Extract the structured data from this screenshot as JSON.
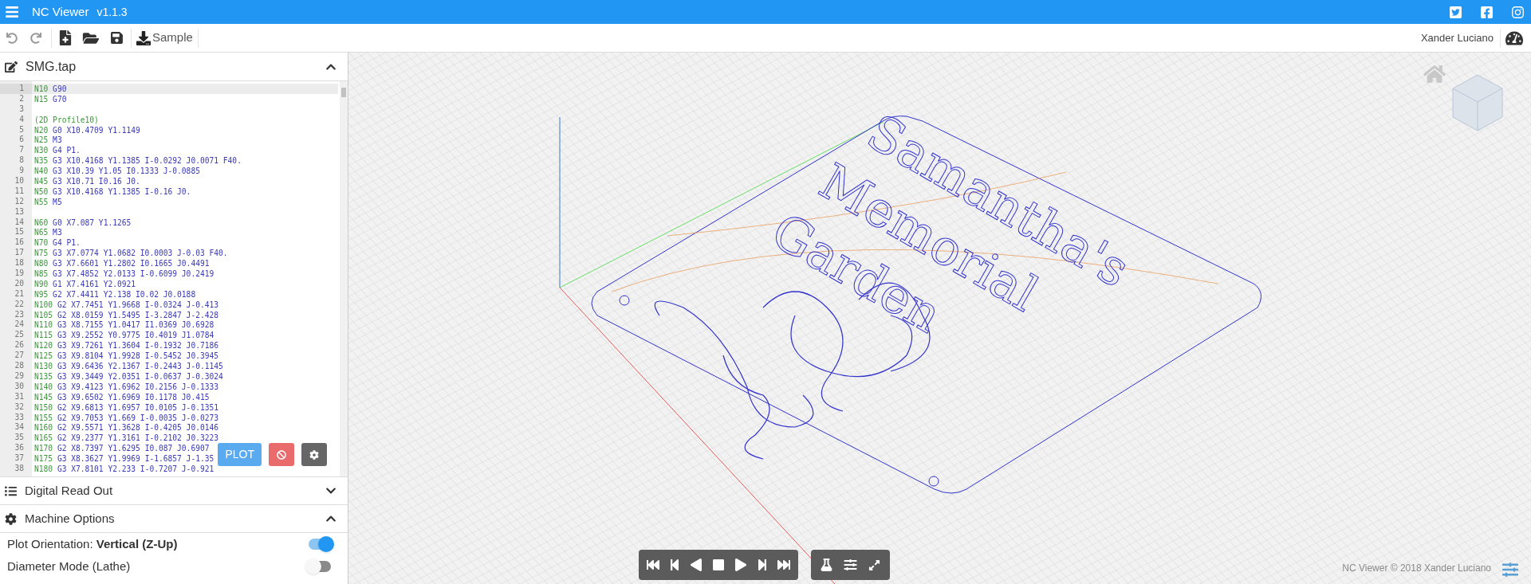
{
  "app_bar": {
    "title": "NC Viewer",
    "version": "v1.1.3"
  },
  "toolbar": {
    "sample_label": "Sample",
    "user": "Xander Luciano"
  },
  "editor": {
    "file_name": "SMG.tap",
    "expanded": true,
    "lines": [
      {
        "number": "1",
        "kind": "block",
        "text": "N10 G90",
        "selected": true
      },
      {
        "number": "2",
        "kind": "block",
        "text": "N15 G70",
        "selected": false
      },
      {
        "number": "3",
        "kind": "blank",
        "selected": false
      },
      {
        "number": "4",
        "kind": "comment",
        "text": "(2D Profile10)",
        "selected": false
      },
      {
        "number": "5",
        "kind": "block",
        "text": "N20 G0 X10.4709 Y1.1149",
        "selected": false
      },
      {
        "number": "6",
        "kind": "block",
        "text": "N25 M3",
        "selected": false
      },
      {
        "number": "7",
        "kind": "block",
        "text": "N30 G4 P1.",
        "selected": false
      },
      {
        "number": "8",
        "kind": "block",
        "text": "N35 G3 X10.4168 Y1.1385 I-0.0292 J0.0071 F40.",
        "selected": false
      },
      {
        "number": "9",
        "kind": "block",
        "text": "N40 G3 X10.39 Y1.05 I0.1333 J-0.0885",
        "selected": false
      },
      {
        "number": "10",
        "kind": "block",
        "text": "N45 G3 X10.71 I0.16 J0.",
        "selected": false
      },
      {
        "number": "11",
        "kind": "block",
        "text": "N50 G3 X10.4168 Y1.1385 I-0.16 J0.",
        "selected": false
      },
      {
        "number": "12",
        "kind": "block",
        "text": "N55 M5",
        "selected": false
      },
      {
        "number": "13",
        "kind": "blank",
        "selected": false
      },
      {
        "number": "14",
        "kind": "block",
        "text": "N60 G0 X7.087 Y1.1265",
        "selected": false
      },
      {
        "number": "15",
        "kind": "block",
        "text": "N65 M3",
        "selected": false
      },
      {
        "number": "16",
        "kind": "block",
        "text": "N70 G4 P1.",
        "selected": false
      },
      {
        "number": "17",
        "kind": "block",
        "text": "N75 G3 X7.0774 Y1.0682 I0.0003 J-0.03 F40.",
        "selected": false
      },
      {
        "number": "18",
        "kind": "block",
        "text": "N80 G3 X7.6601 Y1.2802 I0.1665 J0.4491",
        "selected": false
      },
      {
        "number": "19",
        "kind": "block",
        "text": "N85 G3 X7.4852 Y2.0133 I-0.6099 J0.2419",
        "selected": false
      },
      {
        "number": "20",
        "kind": "block",
        "text": "N90 G1 X7.4161 Y2.0921",
        "selected": false
      },
      {
        "number": "21",
        "kind": "block",
        "text": "N95 G2 X7.4411 Y2.138 I0.02 J0.0188",
        "selected": false
      },
      {
        "number": "22",
        "kind": "block",
        "text": "N100 G2 X7.7451 Y1.9668 I-0.0324 J-0.413",
        "selected": false
      },
      {
        "number": "23",
        "kind": "block",
        "text": "N105 G2 X8.0159 Y1.5495 I-3.2847 J-2.428",
        "selected": false
      },
      {
        "number": "24",
        "kind": "block",
        "text": "N110 G3 X8.7155 Y1.0417 I1.0369 J0.6928",
        "selected": false
      },
      {
        "number": "25",
        "kind": "block",
        "text": "N115 G3 X9.2552 Y0.9775 I0.4019 J1.0784",
        "selected": false
      },
      {
        "number": "26",
        "kind": "block",
        "text": "N120 G3 X9.7261 Y1.3604 I-0.1932 J0.7186",
        "selected": false
      },
      {
        "number": "27",
        "kind": "block",
        "text": "N125 G3 X9.8104 Y1.9928 I-0.5452 J0.3945",
        "selected": false
      },
      {
        "number": "28",
        "kind": "block",
        "text": "N130 G3 X9.6436 Y2.1367 I-0.2443 J-0.1145",
        "selected": false
      },
      {
        "number": "29",
        "kind": "block",
        "text": "N135 G3 X9.3449 Y2.0351 I-0.0637 J-0.3024",
        "selected": false
      },
      {
        "number": "30",
        "kind": "block",
        "text": "N140 G3 X9.4123 Y1.6962 I0.2156 J-0.1333",
        "selected": false
      },
      {
        "number": "31",
        "kind": "block",
        "text": "N145 G3 X9.6502 Y1.6969 I0.1178 J0.415",
        "selected": false
      },
      {
        "number": "32",
        "kind": "block",
        "text": "N150 G2 X9.6813 Y1.6957 I0.0105 J-0.1351",
        "selected": false
      },
      {
        "number": "33",
        "kind": "block",
        "text": "N155 G2 X9.7053 Y1.669 I-0.0035 J-0.0273",
        "selected": false
      },
      {
        "number": "34",
        "kind": "block",
        "text": "N160 G2 X9.5571 Y1.3628 I-0.4205 J0.0146",
        "selected": false
      },
      {
        "number": "35",
        "kind": "block",
        "text": "N165 G2 X9.2377 Y1.3161 I-0.2102 J0.3223",
        "selected": false
      },
      {
        "number": "36",
        "kind": "block",
        "text": "N170 G2 X8.7397 Y1.6295 I0.087 J0.6907",
        "selected": false
      },
      {
        "number": "37",
        "kind": "block",
        "text": "N175 G3 X8.3627 Y1.9969 I-1.6857 J-1.35",
        "selected": false
      },
      {
        "number": "38",
        "kind": "block",
        "text": "N180 G3 X7.8101 Y2.233 I-0.7207 J-0.921",
        "selected": false
      }
    ],
    "plot_button": "PLOT"
  },
  "digital_read_out": {
    "title": "Digital Read Out",
    "expanded": false
  },
  "machine_options": {
    "title": "Machine Options",
    "expanded": true,
    "options": [
      {
        "label": "Plot Orientation: ",
        "value": "Vertical (Z-Up)",
        "on": true
      },
      {
        "label": "Diameter Mode (Lathe)",
        "on": false
      }
    ]
  },
  "viewport": {
    "plate_text": [
      "Samantha's",
      "Memorial",
      "Garden"
    ],
    "footer": "NC Viewer © 2018 Xander Luciano"
  }
}
